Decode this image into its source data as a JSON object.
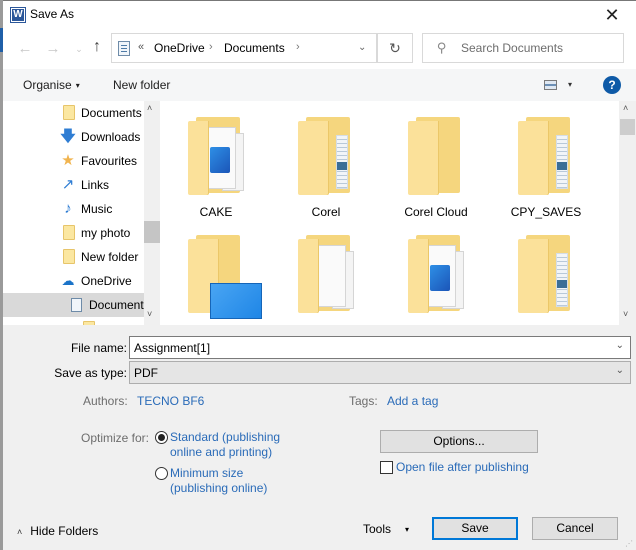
{
  "window": {
    "title": "Save As",
    "app_icon": "word-icon",
    "app_icon_letter": "W",
    "close_glyph": "✕"
  },
  "navigation": {
    "back_glyph": "←",
    "forward_glyph": "→",
    "recent_glyph": "⌄",
    "up_glyph": "↑",
    "overflow_glyph": "«",
    "breadcrumb": [
      "OneDrive",
      "Documents"
    ],
    "separator_glyph": "›",
    "dropdown_glyph": "⌄",
    "refresh_glyph": "↻",
    "search_placeholder": "Search Documents",
    "search_glyph": "⚲"
  },
  "toolbar": {
    "organise_label": "Organise",
    "new_folder_label": "New folder",
    "caret_glyph": "▾",
    "help_glyph": "?"
  },
  "sidebar": {
    "items": [
      {
        "label": "Documents",
        "icon": "folder-icon"
      },
      {
        "label": "Downloads",
        "icon": "download-arrow-icon",
        "glyph": "🡇"
      },
      {
        "label": "Favourites",
        "icon": "star-icon",
        "glyph": "★"
      },
      {
        "label": "Links",
        "icon": "link-arrow-icon",
        "glyph": "↗"
      },
      {
        "label": "Music",
        "icon": "music-note-icon",
        "glyph": "♪"
      },
      {
        "label": "my photo",
        "icon": "folder-icon"
      },
      {
        "label": "New folder",
        "icon": "folder-icon"
      },
      {
        "label": "OneDrive",
        "icon": "cloud-icon",
        "glyph": "☁"
      },
      {
        "label": "Document",
        "icon": "document-icon",
        "selected": true
      },
      {
        "label": "",
        "icon": "folder-icon"
      }
    ],
    "scroll_up_glyph": "˄",
    "scroll_down_glyph": "˅"
  },
  "files": [
    {
      "name": "CAKE",
      "kind": "folder-with-images"
    },
    {
      "name": "Corel",
      "kind": "folder-with-documents"
    },
    {
      "name": "Corel Cloud",
      "kind": "folder-empty"
    },
    {
      "name": "CPY_SAVES",
      "kind": "folder-with-documents"
    },
    {
      "name": "",
      "kind": "folder-with-desktop"
    },
    {
      "name": "",
      "kind": "folder-with-files"
    },
    {
      "name": "",
      "kind": "folder-with-images"
    },
    {
      "name": "",
      "kind": "folder-with-documents"
    }
  ],
  "form": {
    "file_name_label": "File name:",
    "file_name_value": "Assignment[1]",
    "save_type_label": "Save as type:",
    "save_type_value": "PDF",
    "authors_label": "Authors:",
    "authors_value": "TECNO BF6",
    "tags_label": "Tags:",
    "tags_value": "Add a tag",
    "optimize_label": "Optimize for:",
    "optimize_options": [
      {
        "label": "Standard (publishing online and printing)",
        "checked": true
      },
      {
        "label": "Minimum size (publishing online)",
        "checked": false
      }
    ],
    "options_button": "Options...",
    "open_after_label": "Open file after publishing",
    "open_after_checked": false,
    "dropdown_glyph": "⌄"
  },
  "footer": {
    "hide_folders_label": "Hide Folders",
    "hide_glyph": "˄",
    "tools_label": "Tools",
    "save_label": "Save",
    "cancel_label": "Cancel"
  }
}
